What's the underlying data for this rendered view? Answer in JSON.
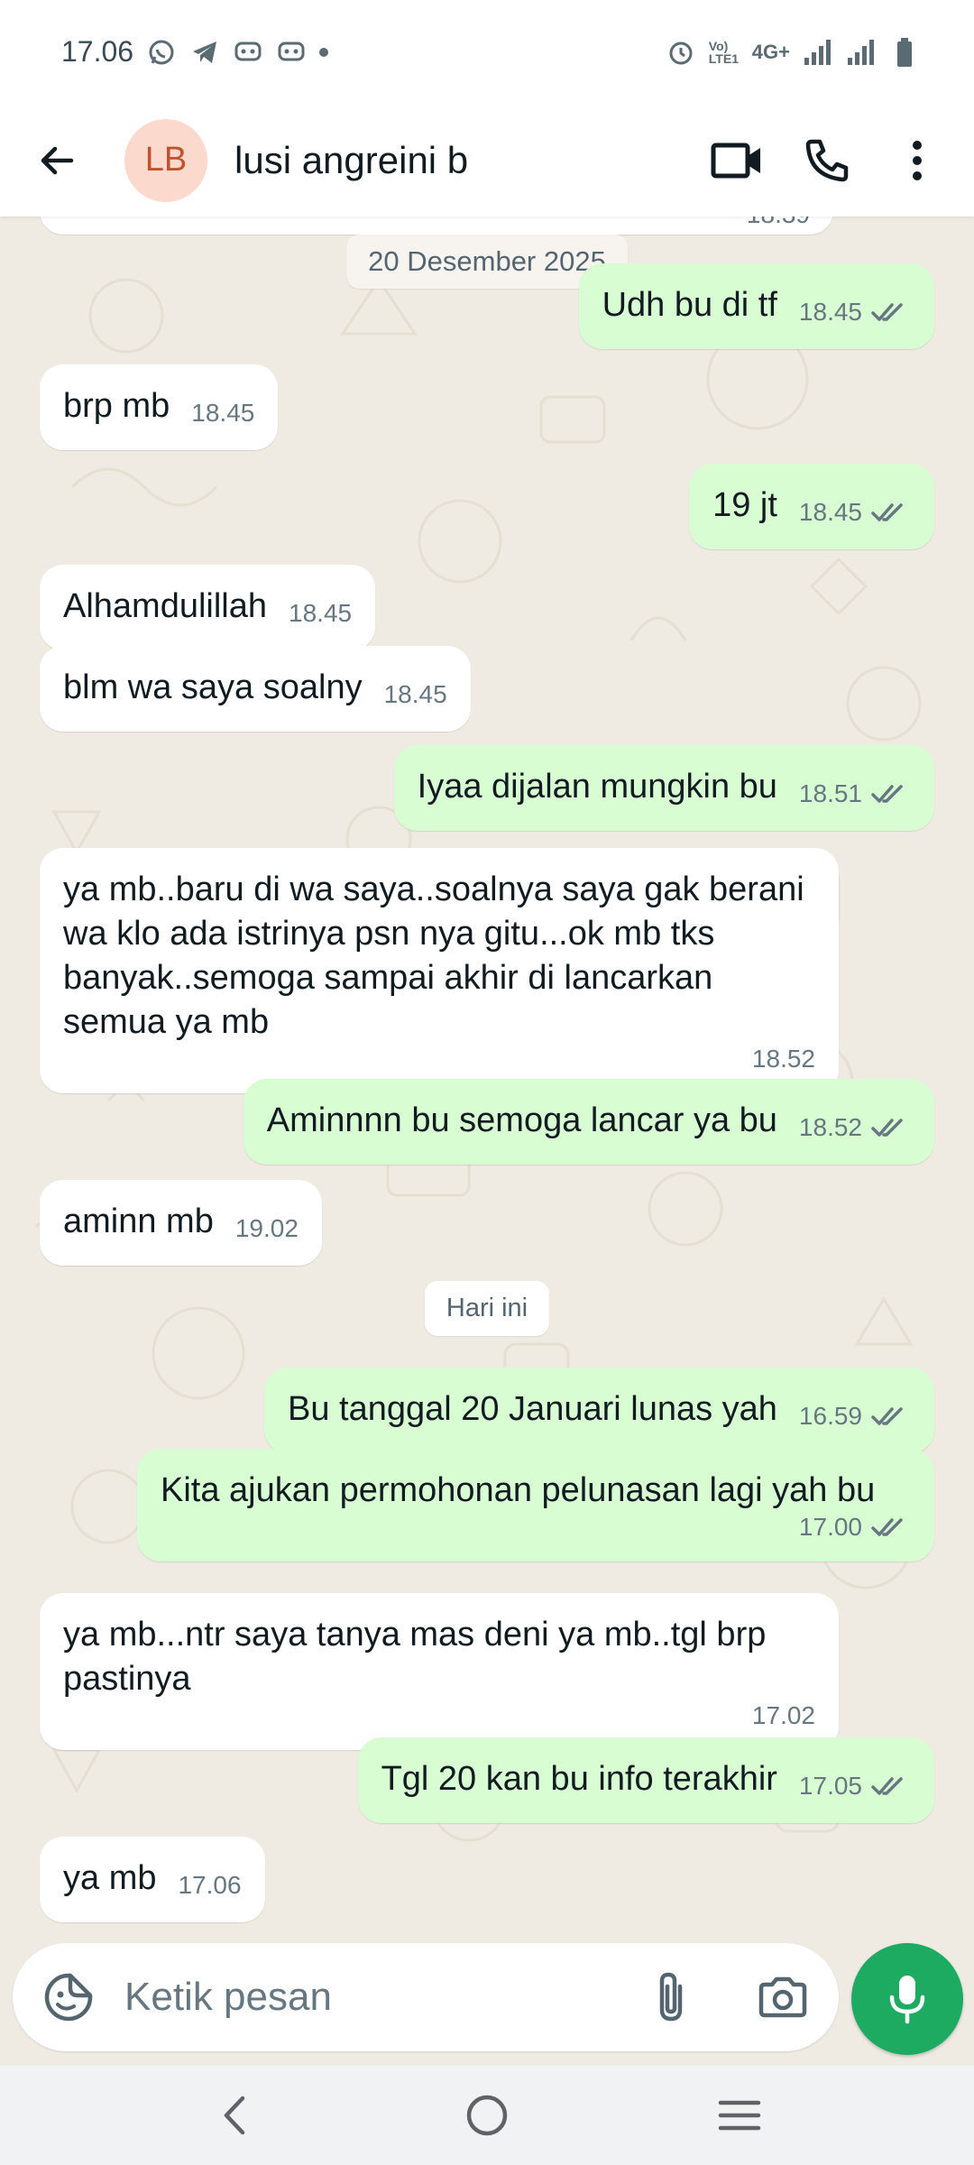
{
  "status_bar": {
    "time": "17.06",
    "network_label": "4G+",
    "volte_label": "Vo) LTE1"
  },
  "header": {
    "avatar_initials": "LB",
    "contact_name": "lusi angreini b"
  },
  "chat": {
    "dates": {
      "first": "20 Desember 2025",
      "today": "Hari ini"
    },
    "partial_top_time": "18.39",
    "messages": [
      {
        "dir": "out",
        "text": "Udh bu di tf",
        "time": "18.45"
      },
      {
        "dir": "in",
        "text": "brp mb",
        "time": "18.45"
      },
      {
        "dir": "out",
        "text": "19 jt",
        "time": "18.45"
      },
      {
        "dir": "in",
        "text": "Alhamdulillah",
        "time": "18.45"
      },
      {
        "dir": "in",
        "text": "blm wa saya soalny",
        "time": "18.45"
      },
      {
        "dir": "out",
        "text": "Iyaa dijalan mungkin bu",
        "time": "18.51"
      },
      {
        "dir": "in",
        "text": "ya mb..baru di wa saya..soalnya saya gak berani wa klo ada istrinya psn nya gitu...ok mb tks banyak..semoga sampai akhir di lancarkan semua ya mb",
        "time": "18.52"
      },
      {
        "dir": "out",
        "text": "Aminnnn bu semoga lancar ya bu",
        "time": "18.52"
      },
      {
        "dir": "in",
        "text": "aminn mb",
        "time": "19.02"
      },
      {
        "dir": "out",
        "text": "Bu tanggal 20 Januari lunas yah",
        "time": "16.59"
      },
      {
        "dir": "out",
        "text": "Kita ajukan permohonan pelunasan lagi yah bu",
        "time": "17.00"
      },
      {
        "dir": "in",
        "text": "ya mb...ntr saya tanya mas deni ya mb..tgl brp pastinya",
        "time": "17.02"
      },
      {
        "dir": "out",
        "text": "Tgl 20 kan bu info terakhir",
        "time": "17.05"
      },
      {
        "dir": "in",
        "text": "ya mb",
        "time": "17.06"
      }
    ]
  },
  "composer": {
    "placeholder": "Ketik pesan"
  },
  "colors": {
    "outgoing_bubble": "#d9fdd3",
    "incoming_bubble": "#ffffff",
    "chat_background": "#efeae2",
    "mic_button": "#1daa61",
    "read_tick": "#53bdeb"
  }
}
